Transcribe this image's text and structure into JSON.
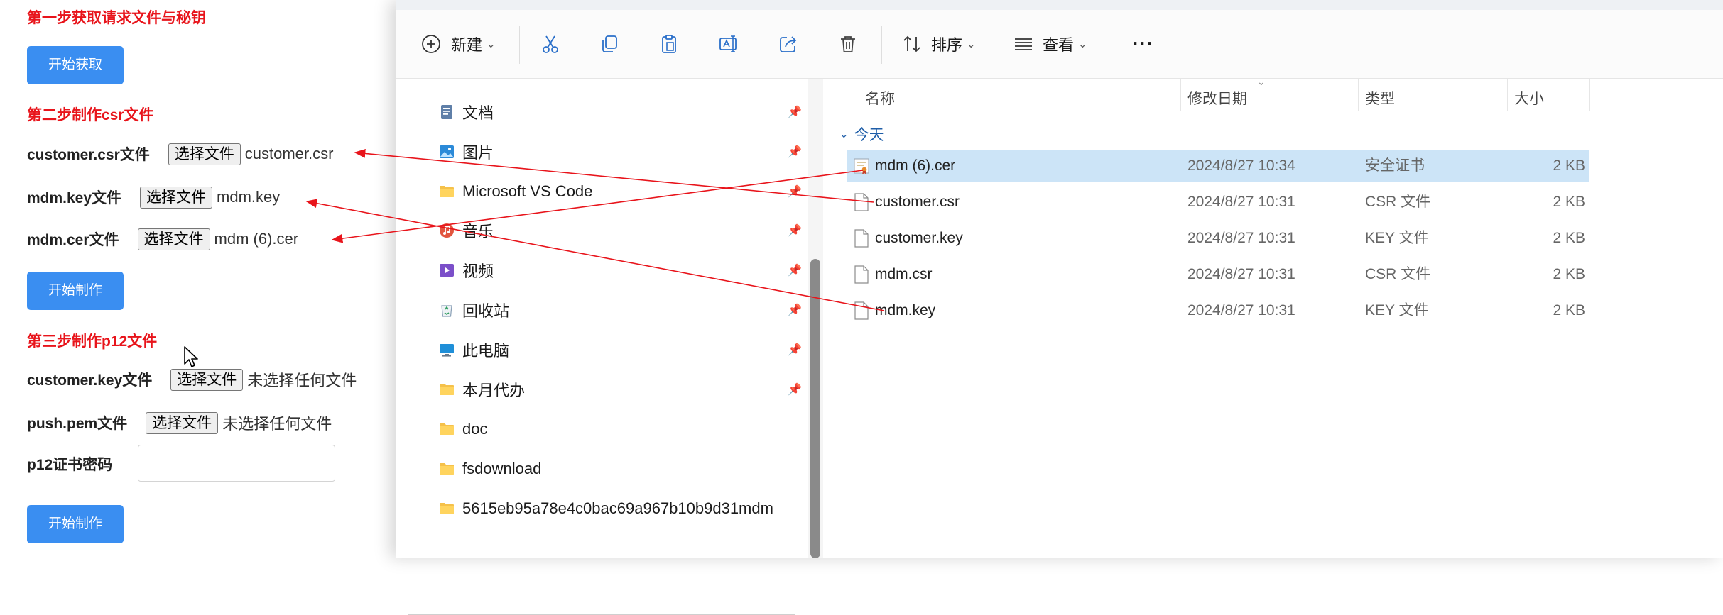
{
  "form": {
    "step1_title": "第一步获取请求文件与秘钥",
    "step1_button": "开始获取",
    "step2_title": "第二步制作csr文件",
    "rows_step2": [
      {
        "label": "customer.csr文件",
        "button": "选择文件",
        "file": "customer.csr"
      },
      {
        "label": "mdm.key文件",
        "button": "选择文件",
        "file": "mdm.key"
      },
      {
        "label": "mdm.cer文件",
        "button": "选择文件",
        "file": "mdm (6).cer"
      }
    ],
    "step2_button": "开始制作",
    "step3_title": "第三步制作p12文件",
    "rows_step3": [
      {
        "label": "customer.key文件",
        "button": "选择文件",
        "file": "未选择任何文件"
      },
      {
        "label": "push.pem文件",
        "button": "选择文件",
        "file": "未选择任何文件"
      }
    ],
    "password_label": "p12证书密码",
    "step3_button": "开始制作"
  },
  "explorer": {
    "toolbar": {
      "new_label": "新建",
      "sort_label": "排序",
      "view_label": "查看",
      "more_label": "···"
    },
    "nav_items": [
      {
        "label": "文档",
        "icon": "document-icon",
        "pinned": true
      },
      {
        "label": "图片",
        "icon": "pictures-icon",
        "pinned": true
      },
      {
        "label": "Microsoft VS Code",
        "icon": "folder-icon",
        "pinned": true
      },
      {
        "label": "音乐",
        "icon": "music-icon",
        "pinned": true
      },
      {
        "label": "视频",
        "icon": "video-icon",
        "pinned": true
      },
      {
        "label": "回收站",
        "icon": "recycle-bin-icon",
        "pinned": true
      },
      {
        "label": "此电脑",
        "icon": "computer-icon",
        "pinned": true
      },
      {
        "label": "本月代办",
        "icon": "folder-icon",
        "pinned": true
      },
      {
        "label": "doc",
        "icon": "folder-icon",
        "pinned": false
      },
      {
        "label": "fsdownload",
        "icon": "folder-icon",
        "pinned": false
      },
      {
        "label": "5615eb95a78e4c0bac69a967b10b9d31mdm",
        "icon": "folder-icon",
        "pinned": false
      }
    ],
    "columns": {
      "name": "名称",
      "date": "修改日期",
      "type": "类型",
      "size": "大小"
    },
    "group": "今天",
    "files": [
      {
        "name": "mdm (6).cer",
        "date": "2024/8/27 10:34",
        "type": "安全证书",
        "size": "2 KB",
        "selected": true,
        "icon": "certificate-icon"
      },
      {
        "name": "customer.csr",
        "date": "2024/8/27 10:31",
        "type": "CSR 文件",
        "size": "2 KB",
        "selected": false,
        "icon": "file-icon"
      },
      {
        "name": "customer.key",
        "date": "2024/8/27 10:31",
        "type": "KEY 文件",
        "size": "2 KB",
        "selected": false,
        "icon": "file-icon"
      },
      {
        "name": "mdm.csr",
        "date": "2024/8/27 10:31",
        "type": "CSR 文件",
        "size": "2 KB",
        "selected": false,
        "icon": "file-icon"
      },
      {
        "name": "mdm.key",
        "date": "2024/8/27 10:31",
        "type": "KEY 文件",
        "size": "2 KB",
        "selected": false,
        "icon": "file-icon"
      }
    ]
  },
  "colors": {
    "step_title": "#e8141b",
    "primary_button": "#3a8ef1",
    "selection": "#cce4f7",
    "annotation_arrow": "#e8141b",
    "group_header": "#1f5ea8"
  }
}
